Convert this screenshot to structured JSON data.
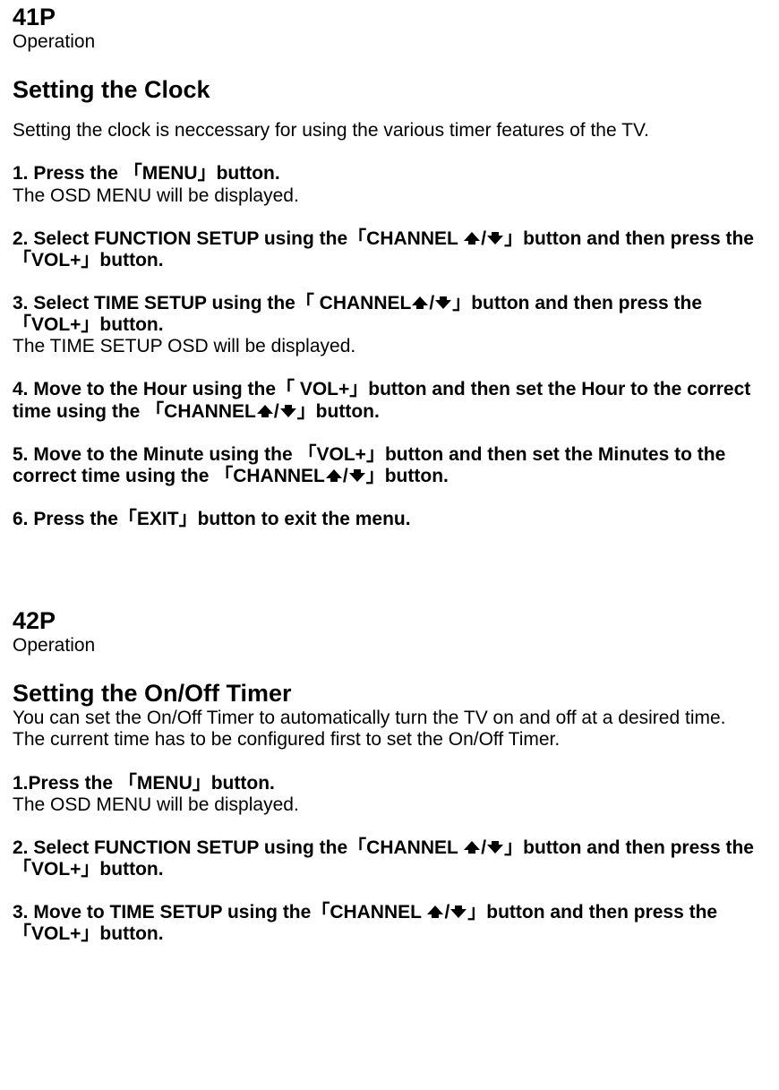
{
  "pages": [
    {
      "number": "41P",
      "section": "Operation",
      "heading": "Setting the Clock",
      "intro": "Setting the clock is neccessary for using the various timer features of the TV.",
      "steps": [
        {
          "bold": "1. Press the 「MENU」button.",
          "follow": "The OSD MENU will be displayed."
        },
        {
          "bold": "2. Select FUNCTION SETUP using the「CHANNEL {up}/{down}」button and then press the 「VOL+」button.",
          "follow": ""
        },
        {
          "bold": "3. Select TIME SETUP using the「 CHANNEL{up}/{down}」button and then press the 「VOL+」button.",
          "follow": "The TIME SETUP OSD will be displayed."
        },
        {
          "bold": "4. Move to the Hour using the「 VOL+」button and then set the Hour to the correct time using the 「CHANNEL{up}/{down}」button.",
          "follow": ""
        },
        {
          "bold": "5. Move to the Minute using the 「VOL+」button and then set the Minutes to the correct time using the 「CHANNEL{up}/{down}」button.",
          "follow": ""
        },
        {
          "bold": "6. Press the「EXIT」button to exit the menu.",
          "follow": ""
        }
      ]
    },
    {
      "number": "42P",
      "section": "Operation",
      "heading": "Setting the On/Off Timer",
      "sub1": "You can set the On/Off Timer to automatically turn the TV on and off at a desired time.",
      "sub2": "The current time has to be configured first to set the On/Off Timer.",
      "steps": [
        {
          "bold": "1.Press the 「MENU」button.",
          "follow": "The OSD MENU will be displayed."
        },
        {
          "bold": "2. Select FUNCTION SETUP using the「CHANNEL {up}/{down}」button and then press the 「VOL+」button.",
          "follow": ""
        },
        {
          "bold": "3. Move to TIME SETUP using the「CHANNEL {up}/{down}」button and then press the 「VOL+」button.",
          "follow": ""
        }
      ]
    }
  ],
  "icons": {
    "up": "▲",
    "down": "▼"
  }
}
